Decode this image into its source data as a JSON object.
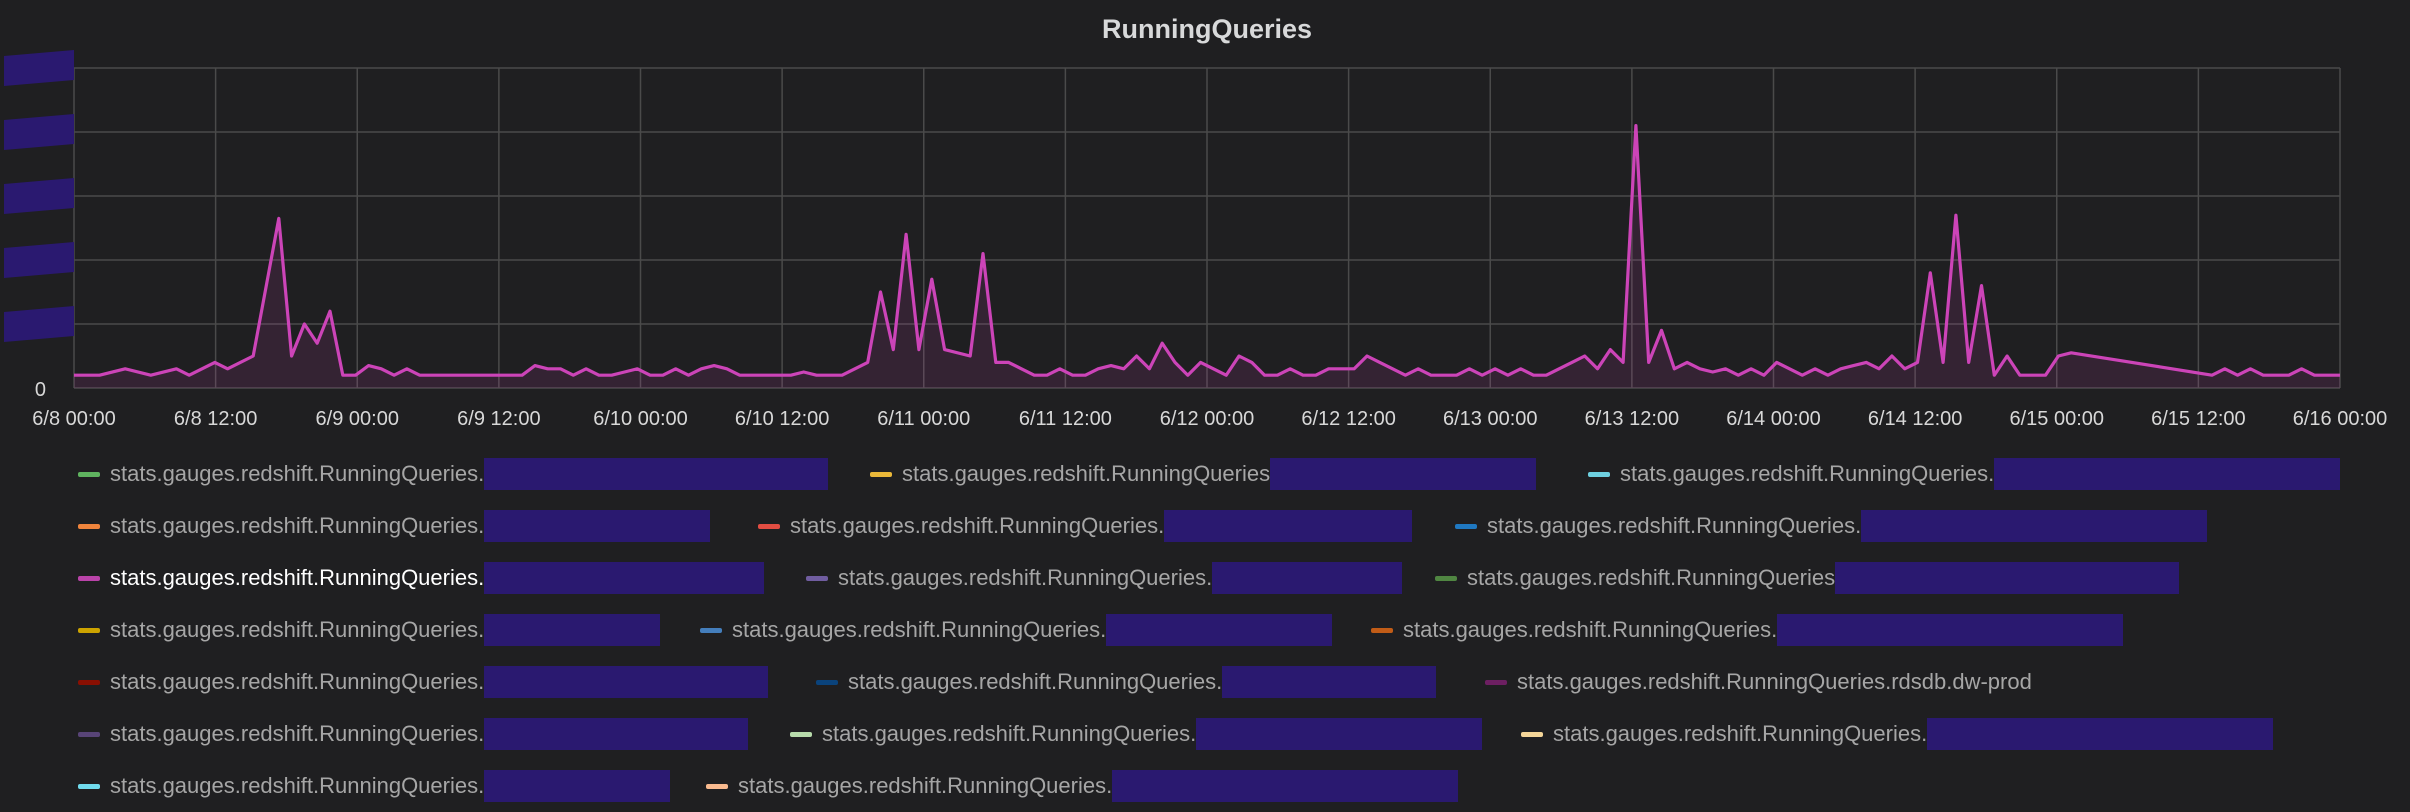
{
  "chart_data": {
    "type": "line",
    "title": "RunningQueries",
    "ylim": [
      0,
      5
    ],
    "y_ticks_visible": [
      "0"
    ],
    "x_ticks": [
      "6/8 00:00",
      "6/8 12:00",
      "6/9 00:00",
      "6/9 12:00",
      "6/10 00:00",
      "6/10 12:00",
      "6/11 00:00",
      "6/11 12:00",
      "6/12 00:00",
      "6/12 12:00",
      "6/13 00:00",
      "6/13 12:00",
      "6/14 00:00",
      "6/14 12:00",
      "6/15 00:00",
      "6/15 12:00",
      "6/16 00:00"
    ],
    "grid": true,
    "legend_placement": "bottom",
    "series": [
      {
        "color": "#cc44b8",
        "points": [
          [
            0,
            0.2
          ],
          [
            2,
            0.2
          ],
          [
            4,
            0.3
          ],
          [
            6,
            0.2
          ],
          [
            8,
            0.3
          ],
          [
            9,
            0.2
          ],
          [
            11,
            0.4
          ],
          [
            12,
            0.3
          ],
          [
            14,
            0.5
          ],
          [
            16,
            2.65
          ],
          [
            17,
            0.5
          ],
          [
            18,
            1.0
          ],
          [
            19,
            0.7
          ],
          [
            20,
            1.2
          ],
          [
            21,
            0.2
          ],
          [
            22,
            0.2
          ],
          [
            23,
            0.35
          ],
          [
            24,
            0.3
          ],
          [
            25,
            0.2
          ],
          [
            26,
            0.3
          ],
          [
            27,
            0.2
          ],
          [
            29,
            0.2
          ],
          [
            30,
            0.2
          ],
          [
            31,
            0.2
          ],
          [
            32,
            0.2
          ],
          [
            33,
            0.2
          ],
          [
            34,
            0.2
          ],
          [
            35,
            0.2
          ],
          [
            36,
            0.35
          ],
          [
            37,
            0.3
          ],
          [
            38,
            0.3
          ],
          [
            39,
            0.2
          ],
          [
            40,
            0.3
          ],
          [
            41,
            0.2
          ],
          [
            42,
            0.2
          ],
          [
            43,
            0.25
          ],
          [
            44,
            0.3
          ],
          [
            45,
            0.2
          ],
          [
            46,
            0.2
          ],
          [
            47,
            0.3
          ],
          [
            48,
            0.2
          ],
          [
            49,
            0.3
          ],
          [
            50,
            0.35
          ],
          [
            51,
            0.3
          ],
          [
            52,
            0.2
          ],
          [
            54,
            0.2
          ],
          [
            56,
            0.2
          ],
          [
            57,
            0.25
          ],
          [
            58,
            0.2
          ],
          [
            60,
            0.2
          ],
          [
            61,
            0.3
          ],
          [
            62,
            0.4
          ],
          [
            63,
            1.5
          ],
          [
            64,
            0.6
          ],
          [
            65,
            2.4
          ],
          [
            66,
            0.6
          ],
          [
            67,
            1.7
          ],
          [
            68,
            0.6
          ],
          [
            70,
            0.5
          ],
          [
            71,
            2.1
          ],
          [
            72,
            0.4
          ],
          [
            73,
            0.4
          ],
          [
            74,
            0.3
          ],
          [
            75,
            0.2
          ],
          [
            76,
            0.2
          ],
          [
            77,
            0.3
          ],
          [
            78,
            0.2
          ],
          [
            79,
            0.2
          ],
          [
            80,
            0.3
          ],
          [
            81,
            0.35
          ],
          [
            82,
            0.3
          ],
          [
            83,
            0.5
          ],
          [
            84,
            0.3
          ],
          [
            85,
            0.7
          ],
          [
            86,
            0.4
          ],
          [
            87,
            0.2
          ],
          [
            88,
            0.4
          ],
          [
            89,
            0.3
          ],
          [
            90,
            0.2
          ],
          [
            91,
            0.5
          ],
          [
            92,
            0.4
          ],
          [
            93,
            0.2
          ],
          [
            94,
            0.2
          ],
          [
            95,
            0.3
          ],
          [
            96,
            0.2
          ],
          [
            97,
            0.2
          ],
          [
            98,
            0.3
          ],
          [
            99,
            0.3
          ],
          [
            100,
            0.3
          ],
          [
            101,
            0.5
          ],
          [
            102,
            0.4
          ],
          [
            103,
            0.3
          ],
          [
            104,
            0.2
          ],
          [
            105,
            0.3
          ],
          [
            106,
            0.2
          ],
          [
            107,
            0.2
          ],
          [
            108,
            0.2
          ],
          [
            109,
            0.3
          ],
          [
            110,
            0.2
          ],
          [
            111,
            0.3
          ],
          [
            112,
            0.2
          ],
          [
            113,
            0.3
          ],
          [
            114,
            0.2
          ],
          [
            115,
            0.2
          ],
          [
            116,
            0.3
          ],
          [
            117,
            0.4
          ],
          [
            118,
            0.5
          ],
          [
            119,
            0.3
          ],
          [
            120,
            0.6
          ],
          [
            121,
            0.4
          ],
          [
            122,
            4.1
          ],
          [
            123,
            0.4
          ],
          [
            124,
            0.9
          ],
          [
            125,
            0.3
          ],
          [
            126,
            0.4
          ],
          [
            127,
            0.3
          ],
          [
            128,
            0.25
          ],
          [
            129,
            0.3
          ],
          [
            130,
            0.2
          ],
          [
            131,
            0.3
          ],
          [
            132,
            0.2
          ],
          [
            133,
            0.4
          ],
          [
            134,
            0.3
          ],
          [
            135,
            0.2
          ],
          [
            136,
            0.3
          ],
          [
            137,
            0.2
          ],
          [
            138,
            0.3
          ],
          [
            139,
            0.35
          ],
          [
            140,
            0.4
          ],
          [
            141,
            0.3
          ],
          [
            142,
            0.5
          ],
          [
            143,
            0.3
          ],
          [
            144,
            0.4
          ],
          [
            145,
            1.8
          ],
          [
            146,
            0.4
          ],
          [
            147,
            2.7
          ],
          [
            148,
            0.4
          ],
          [
            149,
            1.6
          ],
          [
            150,
            0.2
          ],
          [
            151,
            0.5
          ],
          [
            152,
            0.2
          ],
          [
            153,
            0.2
          ],
          [
            154,
            0.2
          ],
          [
            155,
            0.5
          ],
          [
            156,
            0.55
          ],
          [
            167,
            0.2
          ],
          [
            168,
            0.3
          ],
          [
            169,
            0.2
          ],
          [
            170,
            0.3
          ],
          [
            171,
            0.2
          ],
          [
            172,
            0.2
          ],
          [
            173,
            0.2
          ],
          [
            174,
            0.3
          ],
          [
            175,
            0.2
          ],
          [
            176,
            0.2
          ],
          [
            177,
            0.2
          ]
        ]
      }
    ]
  },
  "legend": {
    "rows": [
      [
        {
          "color": "#5fb35f",
          "label": "stats.gauges.redshift.RunningQueries.",
          "redact": 1
        },
        {
          "color": "#eab839",
          "label": "stats.gauges.redshift.RunningQueries",
          "redact": 2
        },
        {
          "color": "#6ed0e0",
          "label": "stats.gauges.redshift.RunningQueries.",
          "redact": 3
        }
      ],
      [
        {
          "color": "#ef843c",
          "label": "stats.gauges.redshift.RunningQueries.",
          "redact": 4
        },
        {
          "color": "#e24d42",
          "label": "stats.gauges.redshift.RunningQueries.",
          "redact": 5
        },
        {
          "color": "#1f78c1",
          "label": "stats.gauges.redshift.RunningQueries.",
          "redact": 6
        }
      ],
      [
        {
          "color": "#ba43a9",
          "label": "stats.gauges.redshift.RunningQueries.",
          "redact": 7,
          "active": true
        },
        {
          "color": "#705da0",
          "label": "stats.gauges.redshift.RunningQueries.",
          "redact": 8
        },
        {
          "color": "#508642",
          "label": "stats.gauges.redshift.RunningQueries",
          "redact": 9
        }
      ],
      [
        {
          "color": "#cca300",
          "label": "stats.gauges.redshift.RunningQueries.",
          "redact": 10
        },
        {
          "color": "#447ebc",
          "label": "stats.gauges.redshift.RunningQueries.",
          "redact": 11
        },
        {
          "color": "#c15c17",
          "label": "stats.gauges.redshift.RunningQueries.",
          "redact": 12
        }
      ],
      [
        {
          "color": "#890f02",
          "label": "stats.gauges.redshift.RunningQueries.",
          "redact": 13
        },
        {
          "color": "#0a437c",
          "label": "stats.gauges.redshift.RunningQueries.",
          "redact": 14
        },
        {
          "color": "#6d1f62",
          "label": "stats.gauges.redshift.RunningQueries.rdsdb.dw-prod",
          "redact": 0
        }
      ],
      [
        {
          "color": "#584477",
          "label": "stats.gauges.redshift.RunningQueries.",
          "redact": 15
        },
        {
          "color": "#b7dbab",
          "label": "stats.gauges.redshift.RunningQueries.",
          "redact": 16
        },
        {
          "color": "#f4d598",
          "label": "stats.gauges.redshift.RunningQueries.",
          "redact": 17
        }
      ],
      [
        {
          "color": "#70dbed",
          "label": "stats.gauges.redshift.RunningQueries.",
          "redact": 18
        },
        {
          "color": "#f9ba8f",
          "label": "stats.gauges.redshift.RunningQueries.",
          "redact": 19
        }
      ]
    ]
  }
}
